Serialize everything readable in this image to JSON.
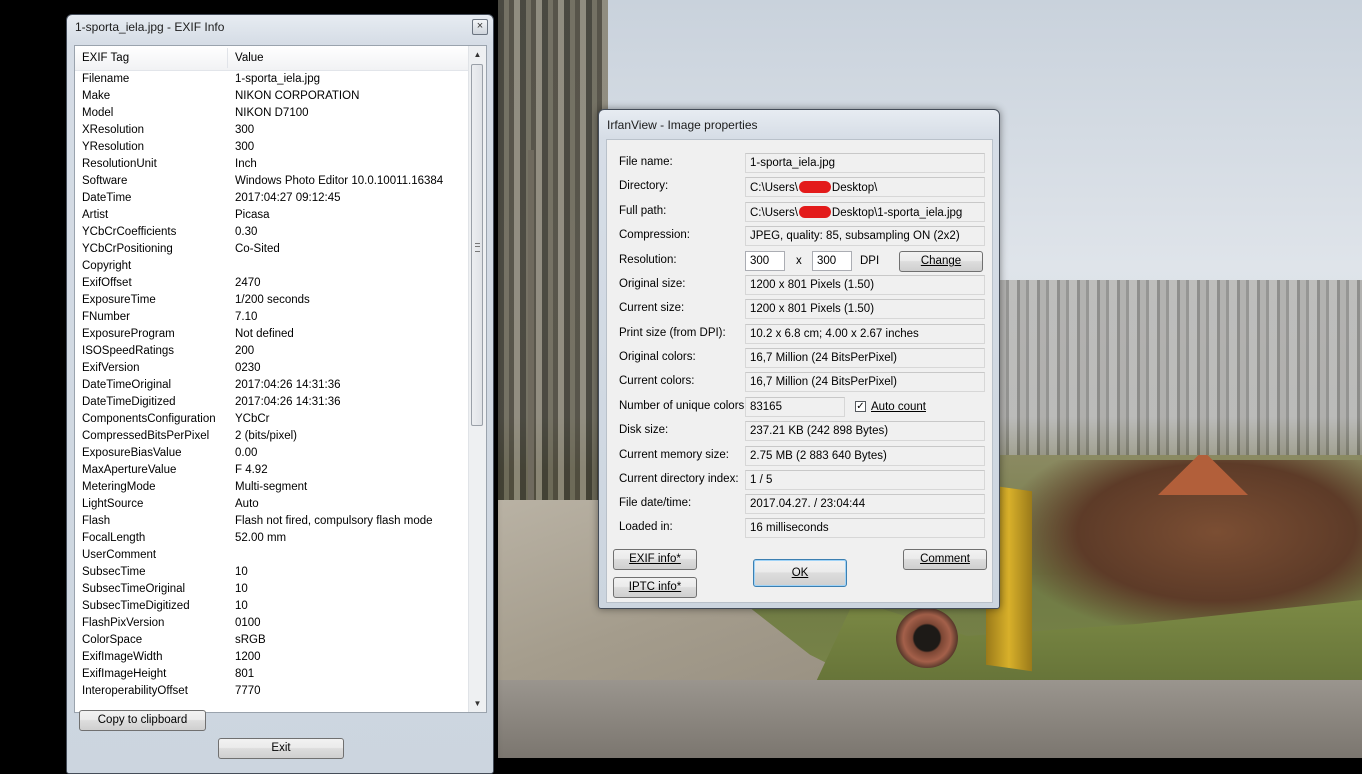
{
  "exif_window": {
    "title": "1-sporta_iela.jpg - EXIF Info",
    "close_glyph": "×",
    "columns": {
      "tag": "EXIF Tag",
      "value": "Value"
    },
    "rows": [
      {
        "tag": "Filename",
        "value": "1-sporta_iela.jpg"
      },
      {
        "tag": "Make",
        "value": "NIKON CORPORATION"
      },
      {
        "tag": "Model",
        "value": "NIKON D7100"
      },
      {
        "tag": "XResolution",
        "value": "300"
      },
      {
        "tag": "YResolution",
        "value": "300"
      },
      {
        "tag": "ResolutionUnit",
        "value": "Inch"
      },
      {
        "tag": "Software",
        "value": "Windows Photo Editor 10.0.10011.16384"
      },
      {
        "tag": "DateTime",
        "value": "2017:04:27 09:12:45"
      },
      {
        "tag": "Artist",
        "value": "Picasa"
      },
      {
        "tag": "YCbCrCoefficients",
        "value": "0.30"
      },
      {
        "tag": "YCbCrPositioning",
        "value": "Co-Sited"
      },
      {
        "tag": "Copyright",
        "value": ""
      },
      {
        "tag": "ExifOffset",
        "value": "2470"
      },
      {
        "tag": "ExposureTime",
        "value": "1/200 seconds"
      },
      {
        "tag": "FNumber",
        "value": "7.10"
      },
      {
        "tag": "ExposureProgram",
        "value": "Not defined"
      },
      {
        "tag": "ISOSpeedRatings",
        "value": "200"
      },
      {
        "tag": "ExifVersion",
        "value": "0230"
      },
      {
        "tag": "DateTimeOriginal",
        "value": "2017:04:26 14:31:36"
      },
      {
        "tag": "DateTimeDigitized",
        "value": "2017:04:26 14:31:36"
      },
      {
        "tag": "ComponentsConfiguration",
        "value": "YCbCr"
      },
      {
        "tag": "CompressedBitsPerPixel",
        "value": "2 (bits/pixel)"
      },
      {
        "tag": "ExposureBiasValue",
        "value": "0.00"
      },
      {
        "tag": "MaxApertureValue",
        "value": "F 4.92"
      },
      {
        "tag": "MeteringMode",
        "value": "Multi-segment"
      },
      {
        "tag": "LightSource",
        "value": "Auto"
      },
      {
        "tag": "Flash",
        "value": "Flash not fired, compulsory flash mode"
      },
      {
        "tag": "FocalLength",
        "value": "52.00 mm"
      },
      {
        "tag": "UserComment",
        "value": ""
      },
      {
        "tag": "SubsecTime",
        "value": "10"
      },
      {
        "tag": "SubsecTimeOriginal",
        "value": "10"
      },
      {
        "tag": "SubsecTimeDigitized",
        "value": "10"
      },
      {
        "tag": "FlashPixVersion",
        "value": "0100"
      },
      {
        "tag": "ColorSpace",
        "value": "sRGB"
      },
      {
        "tag": "ExifImageWidth",
        "value": "1200"
      },
      {
        "tag": "ExifImageHeight",
        "value": "801"
      },
      {
        "tag": "InteroperabilityOffset",
        "value": "7770"
      }
    ],
    "copy_button": "Copy to clipboard",
    "exit_button": "Exit"
  },
  "props_window": {
    "title": "IrfanView - Image properties",
    "labels": {
      "file_name": "File name:",
      "directory": "Directory:",
      "full_path": "Full path:",
      "compression": "Compression:",
      "resolution": "Resolution:",
      "original_size": "Original size:",
      "current_size": "Current size:",
      "print_size": "Print size (from DPI):",
      "original_colors": "Original colors:",
      "current_colors": "Current colors:",
      "unique_colors": "Number of unique colors:",
      "disk_size": "Disk size:",
      "memory_size": "Current memory size:",
      "dir_index": "Current directory index:",
      "file_datetime": "File date/time:",
      "loaded_in": "Loaded in:"
    },
    "values": {
      "file_name": "1-sporta_iela.jpg",
      "directory_prefix": "C:\\Users\\",
      "directory_suffix": "Desktop\\",
      "full_path_prefix": "C:\\Users\\",
      "full_path_suffix": "Desktop\\1-sporta_iela.jpg",
      "compression": "JPEG, quality: 85, subsampling ON (2x2)",
      "resolution_x": "300",
      "resolution_sep": "x",
      "resolution_y": "300",
      "resolution_unit": "DPI",
      "original_size": "1200 x 801  Pixels (1.50)",
      "current_size": "1200 x 801  Pixels (1.50)",
      "print_size": "10.2 x 6.8 cm; 4.00 x 2.67 inches",
      "original_colors": "16,7 Million   (24 BitsPerPixel)",
      "current_colors": "16,7 Million   (24 BitsPerPixel)",
      "unique_colors": "83165",
      "disk_size": "237.21 KB (242 898 Bytes)",
      "memory_size": "2.75  MB (2 883 640 Bytes)",
      "dir_index": "1  /  5",
      "file_datetime": "2017.04.27. / 23:04:44",
      "loaded_in": "16 milliseconds"
    },
    "auto_count_label": "Auto count",
    "auto_count_checked": true,
    "check_glyph": "✓",
    "buttons": {
      "change": "Change",
      "exif_info": "EXIF info*",
      "iptc_info": "IPTC info*",
      "ok": "OK",
      "comment": "Comment"
    },
    "redaction_color": "#e31b1b"
  }
}
